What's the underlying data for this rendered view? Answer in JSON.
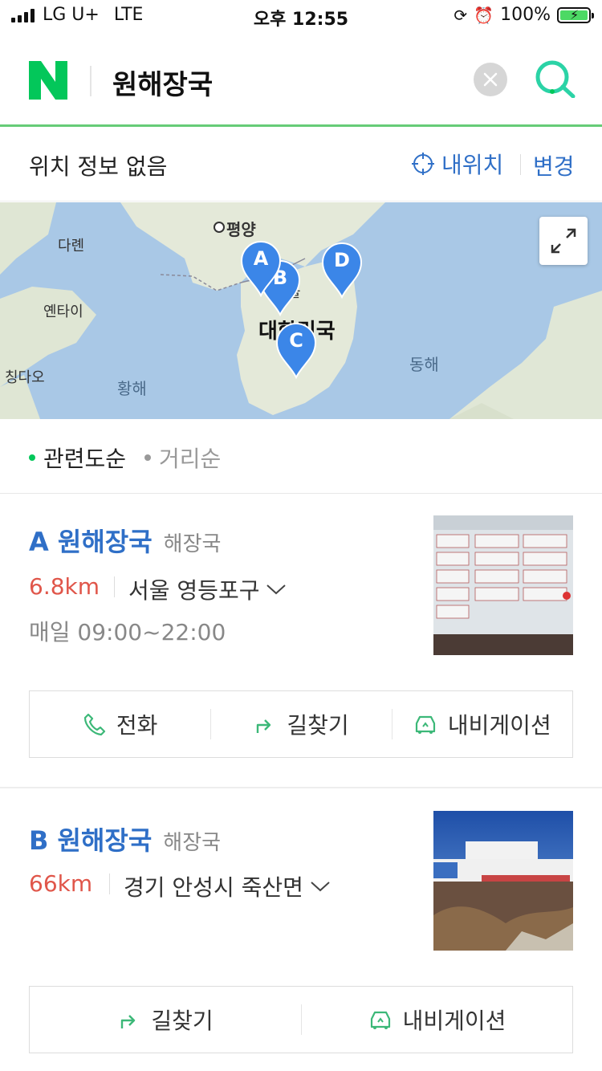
{
  "status_bar": {
    "carrier": "LG U+",
    "network": "LTE",
    "time": "오후 12:55",
    "battery": "100%"
  },
  "search": {
    "query": "원해장국",
    "clear_icon": "close-icon",
    "search_icon": "search-icon"
  },
  "location": {
    "status": "위치 정보 없음",
    "my_location_label": "내위치",
    "change_label": "변경"
  },
  "map": {
    "places": [
      "평양",
      "다롄",
      "옌타이",
      "칭다오"
    ],
    "country": "대한민국",
    "seas": [
      "황해",
      "동해"
    ],
    "seoul_partial": "울",
    "pins": [
      "A",
      "B",
      "C",
      "D"
    ]
  },
  "sort": {
    "options": [
      {
        "label": "관련도순",
        "active": true
      },
      {
        "label": "거리순",
        "active": false
      }
    ]
  },
  "results": [
    {
      "letter": "A",
      "name": "원해장국",
      "category": "해장국",
      "distance": "6.8km",
      "address": "서울 영등포구",
      "hours": "매일 09:00~22:00",
      "actions": [
        "전화",
        "길찾기",
        "내비게이션"
      ]
    },
    {
      "letter": "B",
      "name": "원해장국",
      "category": "해장국",
      "distance": "66km",
      "address": "경기 안성시 죽산면",
      "actions": [
        "길찾기",
        "내비게이션"
      ]
    }
  ],
  "colors": {
    "brand_green": "#03c75a",
    "link_blue": "#2f6fc7",
    "distance_red": "#e0564a",
    "pin_blue": "#3b86e8"
  }
}
